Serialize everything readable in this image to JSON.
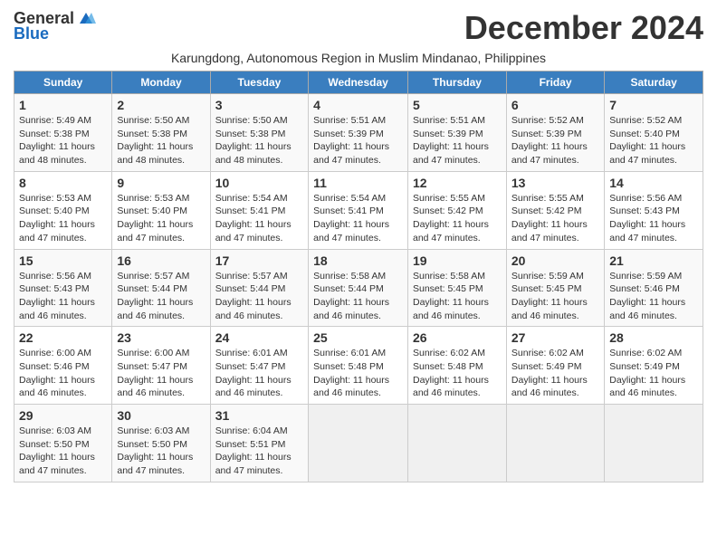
{
  "header": {
    "logo_general": "General",
    "logo_blue": "Blue",
    "month_title": "December 2024",
    "subtitle": "Karungdong, Autonomous Region in Muslim Mindanao, Philippines"
  },
  "calendar": {
    "days_of_week": [
      "Sunday",
      "Monday",
      "Tuesday",
      "Wednesday",
      "Thursday",
      "Friday",
      "Saturday"
    ],
    "weeks": [
      [
        {
          "day": 1,
          "sunrise": "5:49 AM",
          "sunset": "5:38 PM",
          "daylight": "11 hours and 48 minutes."
        },
        {
          "day": 2,
          "sunrise": "5:50 AM",
          "sunset": "5:38 PM",
          "daylight": "11 hours and 48 minutes."
        },
        {
          "day": 3,
          "sunrise": "5:50 AM",
          "sunset": "5:38 PM",
          "daylight": "11 hours and 48 minutes."
        },
        {
          "day": 4,
          "sunrise": "5:51 AM",
          "sunset": "5:39 PM",
          "daylight": "11 hours and 47 minutes."
        },
        {
          "day": 5,
          "sunrise": "5:51 AM",
          "sunset": "5:39 PM",
          "daylight": "11 hours and 47 minutes."
        },
        {
          "day": 6,
          "sunrise": "5:52 AM",
          "sunset": "5:39 PM",
          "daylight": "11 hours and 47 minutes."
        },
        {
          "day": 7,
          "sunrise": "5:52 AM",
          "sunset": "5:40 PM",
          "daylight": "11 hours and 47 minutes."
        }
      ],
      [
        {
          "day": 8,
          "sunrise": "5:53 AM",
          "sunset": "5:40 PM",
          "daylight": "11 hours and 47 minutes."
        },
        {
          "day": 9,
          "sunrise": "5:53 AM",
          "sunset": "5:40 PM",
          "daylight": "11 hours and 47 minutes."
        },
        {
          "day": 10,
          "sunrise": "5:54 AM",
          "sunset": "5:41 PM",
          "daylight": "11 hours and 47 minutes."
        },
        {
          "day": 11,
          "sunrise": "5:54 AM",
          "sunset": "5:41 PM",
          "daylight": "11 hours and 47 minutes."
        },
        {
          "day": 12,
          "sunrise": "5:55 AM",
          "sunset": "5:42 PM",
          "daylight": "11 hours and 47 minutes."
        },
        {
          "day": 13,
          "sunrise": "5:55 AM",
          "sunset": "5:42 PM",
          "daylight": "11 hours and 47 minutes."
        },
        {
          "day": 14,
          "sunrise": "5:56 AM",
          "sunset": "5:43 PM",
          "daylight": "11 hours and 47 minutes."
        }
      ],
      [
        {
          "day": 15,
          "sunrise": "5:56 AM",
          "sunset": "5:43 PM",
          "daylight": "11 hours and 46 minutes."
        },
        {
          "day": 16,
          "sunrise": "5:57 AM",
          "sunset": "5:44 PM",
          "daylight": "11 hours and 46 minutes."
        },
        {
          "day": 17,
          "sunrise": "5:57 AM",
          "sunset": "5:44 PM",
          "daylight": "11 hours and 46 minutes."
        },
        {
          "day": 18,
          "sunrise": "5:58 AM",
          "sunset": "5:44 PM",
          "daylight": "11 hours and 46 minutes."
        },
        {
          "day": 19,
          "sunrise": "5:58 AM",
          "sunset": "5:45 PM",
          "daylight": "11 hours and 46 minutes."
        },
        {
          "day": 20,
          "sunrise": "5:59 AM",
          "sunset": "5:45 PM",
          "daylight": "11 hours and 46 minutes."
        },
        {
          "day": 21,
          "sunrise": "5:59 AM",
          "sunset": "5:46 PM",
          "daylight": "11 hours and 46 minutes."
        }
      ],
      [
        {
          "day": 22,
          "sunrise": "6:00 AM",
          "sunset": "5:46 PM",
          "daylight": "11 hours and 46 minutes."
        },
        {
          "day": 23,
          "sunrise": "6:00 AM",
          "sunset": "5:47 PM",
          "daylight": "11 hours and 46 minutes."
        },
        {
          "day": 24,
          "sunrise": "6:01 AM",
          "sunset": "5:47 PM",
          "daylight": "11 hours and 46 minutes."
        },
        {
          "day": 25,
          "sunrise": "6:01 AM",
          "sunset": "5:48 PM",
          "daylight": "11 hours and 46 minutes."
        },
        {
          "day": 26,
          "sunrise": "6:02 AM",
          "sunset": "5:48 PM",
          "daylight": "11 hours and 46 minutes."
        },
        {
          "day": 27,
          "sunrise": "6:02 AM",
          "sunset": "5:49 PM",
          "daylight": "11 hours and 46 minutes."
        },
        {
          "day": 28,
          "sunrise": "6:02 AM",
          "sunset": "5:49 PM",
          "daylight": "11 hours and 46 minutes."
        }
      ],
      [
        {
          "day": 29,
          "sunrise": "6:03 AM",
          "sunset": "5:50 PM",
          "daylight": "11 hours and 47 minutes."
        },
        {
          "day": 30,
          "sunrise": "6:03 AM",
          "sunset": "5:50 PM",
          "daylight": "11 hours and 47 minutes."
        },
        {
          "day": 31,
          "sunrise": "6:04 AM",
          "sunset": "5:51 PM",
          "daylight": "11 hours and 47 minutes."
        },
        null,
        null,
        null,
        null
      ]
    ]
  }
}
